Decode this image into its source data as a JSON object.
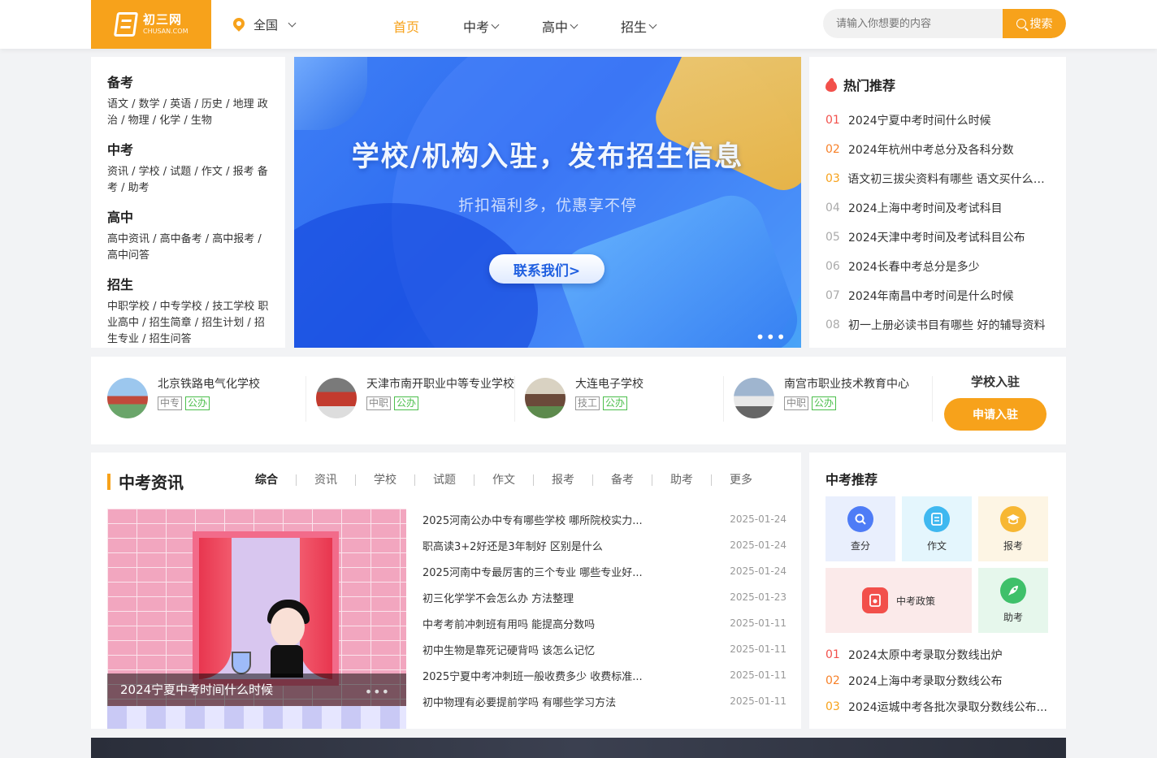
{
  "header": {
    "logo_cn": "初三网",
    "logo_en": "CHUSAN.COM",
    "location": "全国",
    "nav": [
      {
        "label": "首页"
      },
      {
        "label": "中考"
      },
      {
        "label": "高中"
      },
      {
        "label": "招生"
      }
    ],
    "search_placeholder": "请输入你想要的内容",
    "search_button": "搜索"
  },
  "categories": [
    {
      "title": "备考",
      "links": "语文 / 数学 / 英语 / 历史 / 地理 政治 / 物理 / 化学 / 生物"
    },
    {
      "title": "中考",
      "links": "资讯 / 学校 / 试题 / 作文 / 报考 备考 / 助考"
    },
    {
      "title": "高中",
      "links": "高中资讯 / 高中备考 / 高中报考 / 高中问答"
    },
    {
      "title": "招生",
      "links": "中职学校 / 中专学校 / 技工学校 职业高中 / 招生简章 / 招生计划 / 招生专业 / 招生问答"
    }
  ],
  "banner": {
    "title": "学校/机构入驻，发布招生信息",
    "subtitle": "折扣福利多，优惠享不停",
    "button": "联系我们>",
    "dots": "•••"
  },
  "hot": {
    "title": "热门推荐",
    "items": [
      {
        "num": "01",
        "text": "2024宁夏中考时间什么时候"
      },
      {
        "num": "02",
        "text": "2024年杭州中考总分及各科分数"
      },
      {
        "num": "03",
        "text": "语文初三拔尖资料有哪些 语文买什么刷..."
      },
      {
        "num": "04",
        "text": "2024上海中考时间及考试科目"
      },
      {
        "num": "05",
        "text": "2024天津中考时间及考试科目公布"
      },
      {
        "num": "06",
        "text": "2024长春中考总分是多少"
      },
      {
        "num": "07",
        "text": "2024年南昌中考时间是什么时候"
      },
      {
        "num": "08",
        "text": "初一上册必读书目有哪些 好的辅导资料"
      }
    ]
  },
  "schools": {
    "items": [
      {
        "name": "北京铁路电气化学校",
        "tag1": "中专",
        "tag2": "公办"
      },
      {
        "name": "天津市南开职业中等专业学校",
        "tag1": "中职",
        "tag2": "公办"
      },
      {
        "name": "大连电子学校",
        "tag1": "技工",
        "tag2": "公办"
      },
      {
        "name": "南宫市职业技术教育中心",
        "tag1": "中职",
        "tag2": "公办"
      }
    ],
    "join_title": "学校入驻",
    "join_button": "申请入驻"
  },
  "news": {
    "title": "中考资讯",
    "tabs": [
      "综合",
      "资讯",
      "学校",
      "试题",
      "作文",
      "报考",
      "备考",
      "助考",
      "更多"
    ],
    "image_caption": "2024宁夏中考时间什么时候",
    "image_dots": "•••",
    "items": [
      {
        "text": "2025河南公办中专有哪些学校 哪所院校实力...",
        "date": "2025-01-24"
      },
      {
        "text": "职高读3+2好还是3年制好 区别是什么",
        "date": "2025-01-24"
      },
      {
        "text": "2025河南中专最厉害的三个专业 哪些专业好...",
        "date": "2025-01-24"
      },
      {
        "text": "初三化学学不会怎么办 方法整理",
        "date": "2025-01-23"
      },
      {
        "text": "中考考前冲刺班有用吗 能提高分数吗",
        "date": "2025-01-11"
      },
      {
        "text": "初中生物是靠死记硬背吗 该怎么记忆",
        "date": "2025-01-11"
      },
      {
        "text": "2025宁夏中考冲刺班一般收费多少 收费标准...",
        "date": "2025-01-11"
      },
      {
        "text": "初中物理有必要提前学吗 有哪些学习方法",
        "date": "2025-01-11"
      }
    ]
  },
  "recommend": {
    "title": "中考推荐",
    "cards": [
      {
        "label": "查分",
        "icon": "search-icon",
        "color": "#4e7cf6",
        "bg": "#e9effd"
      },
      {
        "label": "作文",
        "icon": "document-icon",
        "color": "#3fb8f0",
        "bg": "#e4f6fd"
      },
      {
        "label": "报考",
        "icon": "graduation-cap-icon",
        "color": "#f7b733",
        "bg": "#fdf5e4"
      },
      {
        "label": "中考政策",
        "icon": "policy-icon",
        "color": "#f2504b",
        "bg": "#fbeaea"
      },
      {
        "label": "助考",
        "icon": "rocket-icon",
        "color": "#3fc06a",
        "bg": "#e6f7ec"
      }
    ],
    "items": [
      {
        "num": "01",
        "text": "2024太原中考录取分数线出炉"
      },
      {
        "num": "02",
        "text": "2024上海中考录取分数线公布"
      },
      {
        "num": "03",
        "text": "2024运城中考各批次录取分数线公布..."
      }
    ]
  },
  "colors": {
    "accent": "#f7a21b",
    "hot_red": "#f2504b"
  }
}
